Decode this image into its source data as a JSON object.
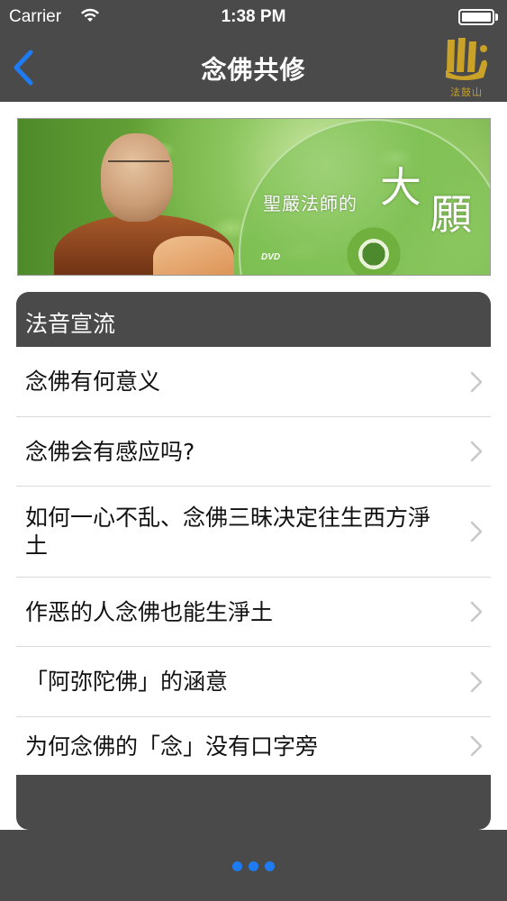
{
  "status_bar": {
    "carrier": "Carrier",
    "time": "1:38 PM",
    "wifi_icon": "wifi-icon",
    "battery_icon": "battery-icon"
  },
  "nav_bar": {
    "back_icon": "chevron-left-icon",
    "title": "念佛共修",
    "logo_icon": "dharma-drum-logo",
    "logo_text": "法鼓山",
    "accent_color": "#1f7bf2"
  },
  "banner": {
    "caption": "聖嚴法師的",
    "big_char_1": "大",
    "big_char_2": "願",
    "dvd_label": "DVD"
  },
  "section": {
    "header": "法音宣流",
    "items": [
      {
        "label": "念佛有何意义"
      },
      {
        "label": "念佛会有感应吗?"
      },
      {
        "label": "如何一心不乱、念佛三昧决定往生西方淨土"
      },
      {
        "label": "作恶的人念佛也能生淨土"
      },
      {
        "label": "「阿弥陀佛」的涵意"
      },
      {
        "label": "为何念佛的「念」没有口字旁"
      }
    ]
  },
  "bottom_bar": {
    "more_icon": "more-dots-icon"
  },
  "colors": {
    "bar_background": "#4a4a4a",
    "separator": "#d9d9d9",
    "chevron": "#c7c7cc"
  }
}
